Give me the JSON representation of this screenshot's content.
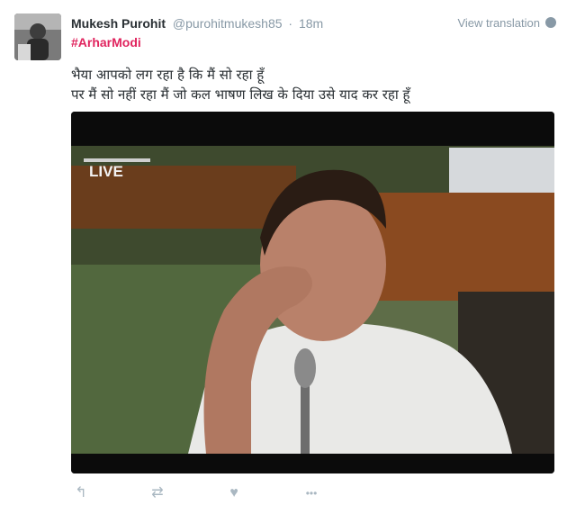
{
  "tweet": {
    "user_name": "Mukesh Purohit",
    "handle": "@purohitmukesh85",
    "separator": "·",
    "time": "18m",
    "view_translation": "View translation",
    "hashtag": "#ArharModi",
    "text_line1": "भैया आपको लग रहा है कि मैं सो रहा हूँ",
    "text_line2": "पर मैं सो नहीं रहा मैं जो कल भाषण लिख के दिया उसे याद कर रहा हूँ",
    "media_badge": "LIVE"
  },
  "actions": {
    "reply_icon": "↰",
    "retweet_icon": "⇄",
    "like_icon": "♥",
    "more_icon": "•••"
  },
  "colors": {
    "hashtag": "#e0245e",
    "muted": "#8899a6",
    "text": "#292f33"
  },
  "icons": [
    "avatar",
    "globe-icon",
    "reply-icon",
    "retweet-icon",
    "like-icon",
    "more-icon"
  ]
}
